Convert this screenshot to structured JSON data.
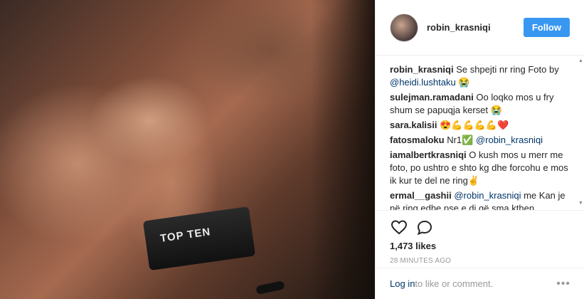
{
  "post": {
    "author": "robin_krasniqi",
    "follow_label": "Follow",
    "photo_text": "TOP TEN",
    "caption": {
      "user": "robin_krasniqi",
      "text": " Se shpejti nr ring Foto by ",
      "mention": "@heidi.lushtaku",
      "emoji": " 😭"
    },
    "comments": [
      {
        "user": "sulejman.ramadani",
        "text": " Oo loqko mos u fry shum se papuqja kerset 😭",
        "mention": ""
      },
      {
        "user": "sara.kalisii",
        "text": " 😍💪💪💪💪❤️",
        "mention": ""
      },
      {
        "user": "fatosmaloku",
        "text": " Nr1✅ ",
        "mention": "@robin_krasniqi"
      },
      {
        "user": "iamalbertkrasniqi",
        "text": " O kush mos u merr me foto, po ushtro e shto kg dhe forcohu e mos ik kur te del ne ring✌️",
        "mention": ""
      },
      {
        "user": "ermal__gashii",
        "text": " me Kan je në ring edhe pse e di që sma kthen komentin",
        "mention": "@robin_krasniqi",
        "mention_first": true
      }
    ],
    "likes": "1,473 likes",
    "time": "28 MINUTES AGO"
  },
  "footer": {
    "login_label": "Log in",
    "rest": " to like or comment.",
    "more": "•••"
  },
  "icons": {
    "like": "heart-icon",
    "comment": "comment-icon",
    "more": "more-options-icon"
  }
}
